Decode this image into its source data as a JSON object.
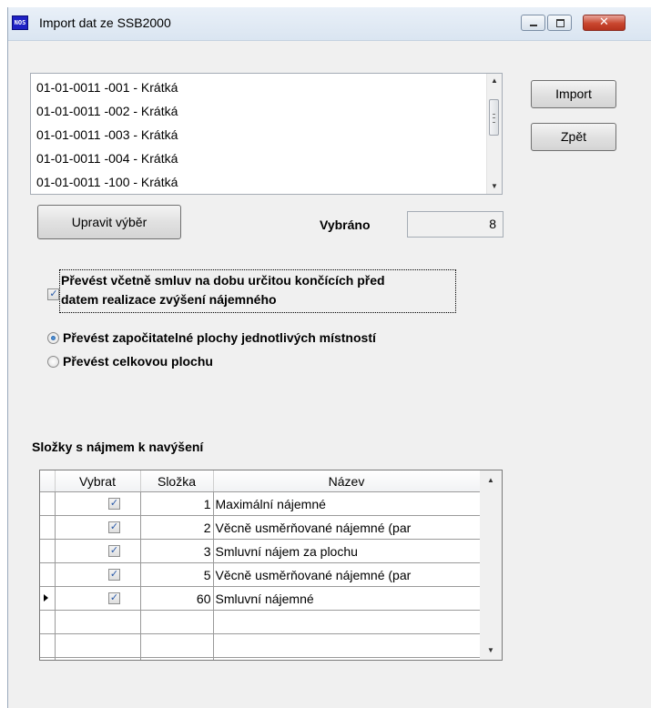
{
  "window": {
    "title": "Import dat ze SSB2000",
    "icon_text": "NOS",
    "buttons": {
      "minimize": "minimize-icon",
      "maximize": "maximize-icon",
      "close": "✕"
    }
  },
  "selection_list": {
    "items": [
      "01-01-0011 -001 - Krátká",
      "01-01-0011 -002 - Krátká",
      "01-01-0011 -003 - Krátká",
      "01-01-0011 -004 - Krátká",
      "01-01-0011 -100 - Krátká"
    ]
  },
  "actions": {
    "import_label": "Import",
    "back_label": "Zpět",
    "edit_selection_label": "Upravit výběr"
  },
  "selected": {
    "label": "Vybráno",
    "count": "8"
  },
  "options": {
    "include_fixed_term": {
      "line1": "Převést včetně smluv na dobu určitou končících před",
      "line2": "datem realizace zvýšení nájemného",
      "checked": true
    },
    "area_mode": {
      "room_areas": "Převést započitatelné plochy jednotlivých místností",
      "total_area": "Převést celkovou plochu",
      "selected": "room_areas"
    }
  },
  "components": {
    "title": "Složky s nájmem k navýšení",
    "columns": {
      "select": "Vybrat",
      "component": "Složka",
      "name": "Název"
    },
    "rows": [
      {
        "checked": true,
        "component": "1",
        "name": "Maximální nájemné"
      },
      {
        "checked": true,
        "component": "2",
        "name": "Věcně usměrňované nájemné (par"
      },
      {
        "checked": true,
        "component": "3",
        "name": "Smluvní nájem za plochu"
      },
      {
        "checked": true,
        "component": "5",
        "name": "Věcně usměrňované nájemné (par"
      },
      {
        "checked": true,
        "component": "60",
        "name": "Smluvní nájemné",
        "current": true
      }
    ]
  },
  "colors": {
    "title_bar": "#dae5f1",
    "close_button": "#c9472f",
    "check_tick": "#2a5aa8",
    "window_bg": "#f0f0f0"
  }
}
